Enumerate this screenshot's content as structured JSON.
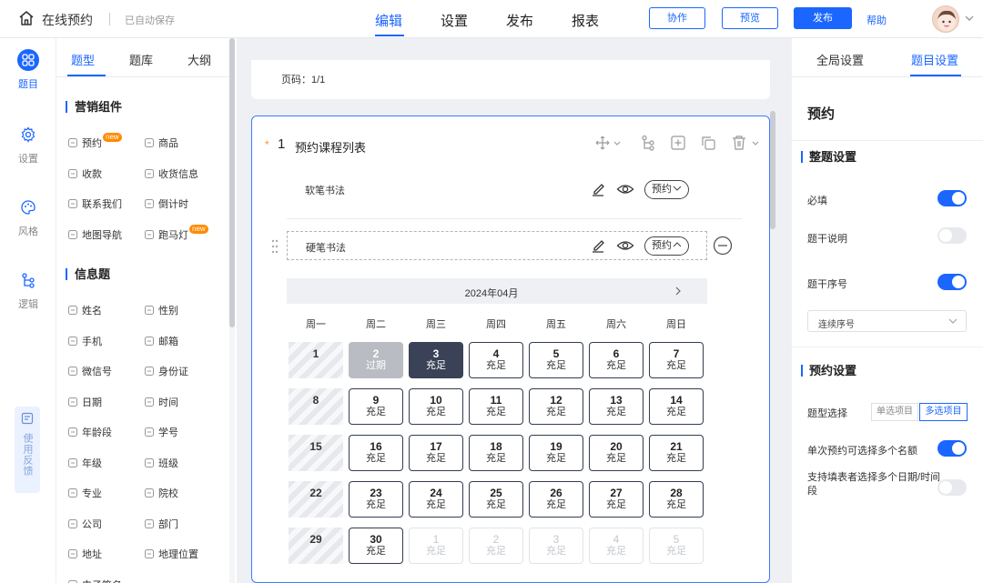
{
  "topbar": {
    "title": "在线预约",
    "saved": "已自动保存",
    "nav": [
      "编辑",
      "设置",
      "发布",
      "报表"
    ],
    "collab": "协作",
    "preview": "预览",
    "publish": "发布",
    "help": "帮助"
  },
  "rail": {
    "items": [
      {
        "label": "题目",
        "icon": "grid-icon"
      },
      {
        "label": "设置",
        "icon": "gear-icon"
      },
      {
        "label": "风格",
        "icon": "palette-icon"
      },
      {
        "label": "逻辑",
        "icon": "logic-icon"
      }
    ],
    "feedback": "使用反馈"
  },
  "panel": {
    "tabs": [
      "题型",
      "题库",
      "大纲"
    ],
    "marketing_title": "营销组件",
    "new_badge": "new",
    "marketing": [
      {
        "label": "预约",
        "badge": true
      },
      {
        "label": "商品"
      },
      {
        "label": "收款"
      },
      {
        "label": "收货信息"
      },
      {
        "label": "联系我们"
      },
      {
        "label": "倒计时"
      },
      {
        "label": "地图导航"
      },
      {
        "label": "跑马灯",
        "badge": true
      }
    ],
    "info_title": "信息题",
    "info": [
      {
        "label": "姓名"
      },
      {
        "label": "性别"
      },
      {
        "label": "手机"
      },
      {
        "label": "邮箱"
      },
      {
        "label": "微信号"
      },
      {
        "label": "身份证"
      },
      {
        "label": "日期"
      },
      {
        "label": "时间"
      },
      {
        "label": "年龄段"
      },
      {
        "label": "学号"
      },
      {
        "label": "年级"
      },
      {
        "label": "班级"
      },
      {
        "label": "专业"
      },
      {
        "label": "院校"
      },
      {
        "label": "公司"
      },
      {
        "label": "部门"
      },
      {
        "label": "地址"
      },
      {
        "label": "地理位置"
      },
      {
        "label": "电子签名"
      }
    ]
  },
  "canvas": {
    "page_label": "页码：1/1",
    "question": {
      "star": "*",
      "number": "1",
      "title": "预约课程列表",
      "options": [
        {
          "text": "软笔书法",
          "tag": "预约",
          "caret": "down"
        },
        {
          "text": "硬笔书法",
          "tag": "预约",
          "caret": "up"
        }
      ]
    },
    "calendar": {
      "month": "2024年04月",
      "weekdays": [
        "周一",
        "周二",
        "周三",
        "周四",
        "周五",
        "周六",
        "周日"
      ],
      "weeks": [
        [
          {
            "n": "1",
            "s": "",
            "state": "blank"
          },
          {
            "n": "2",
            "s": "过期",
            "state": "past"
          },
          {
            "n": "3",
            "s": "充足",
            "state": "sel"
          },
          {
            "n": "4",
            "s": "充足",
            "state": "normal"
          },
          {
            "n": "5",
            "s": "充足",
            "state": "normal"
          },
          {
            "n": "6",
            "s": "充足",
            "state": "normal"
          },
          {
            "n": "7",
            "s": "充足",
            "state": "normal"
          }
        ],
        [
          {
            "n": "8",
            "s": "",
            "state": "blank"
          },
          {
            "n": "9",
            "s": "充足",
            "state": "normal"
          },
          {
            "n": "10",
            "s": "充足",
            "state": "normal"
          },
          {
            "n": "11",
            "s": "充足",
            "state": "normal"
          },
          {
            "n": "12",
            "s": "充足",
            "state": "normal"
          },
          {
            "n": "13",
            "s": "充足",
            "state": "normal"
          },
          {
            "n": "14",
            "s": "充足",
            "state": "normal"
          }
        ],
        [
          {
            "n": "15",
            "s": "",
            "state": "blank"
          },
          {
            "n": "16",
            "s": "充足",
            "state": "normal"
          },
          {
            "n": "17",
            "s": "充足",
            "state": "normal"
          },
          {
            "n": "18",
            "s": "充足",
            "state": "normal"
          },
          {
            "n": "19",
            "s": "充足",
            "state": "normal"
          },
          {
            "n": "20",
            "s": "充足",
            "state": "normal"
          },
          {
            "n": "21",
            "s": "充足",
            "state": "normal"
          }
        ],
        [
          {
            "n": "22",
            "s": "",
            "state": "blank"
          },
          {
            "n": "23",
            "s": "充足",
            "state": "normal"
          },
          {
            "n": "24",
            "s": "充足",
            "state": "normal"
          },
          {
            "n": "25",
            "s": "充足",
            "state": "normal"
          },
          {
            "n": "26",
            "s": "充足",
            "state": "normal"
          },
          {
            "n": "27",
            "s": "充足",
            "state": "normal"
          },
          {
            "n": "28",
            "s": "充足",
            "state": "normal"
          }
        ],
        [
          {
            "n": "29",
            "s": "",
            "state": "blank"
          },
          {
            "n": "30",
            "s": "充足",
            "state": "normal"
          },
          {
            "n": "1",
            "s": "充足",
            "state": "muted"
          },
          {
            "n": "2",
            "s": "充足",
            "state": "muted"
          },
          {
            "n": "3",
            "s": "充足",
            "state": "muted"
          },
          {
            "n": "4",
            "s": "充足",
            "state": "muted"
          },
          {
            "n": "5",
            "s": "充足",
            "state": "muted"
          }
        ]
      ]
    }
  },
  "settings": {
    "tabs": [
      "全局设置",
      "题目设置"
    ],
    "heading": "预约",
    "whole_title": "整题设置",
    "required": "必填",
    "description": "题干说明",
    "numbering": "题干序号",
    "numbering_select": "连续序号",
    "booking_title": "预约设置",
    "type_label": "题型选择",
    "type_options": [
      "单选项目",
      "多选项目"
    ],
    "multi_quota": "单次预约可选择多个名额",
    "multi_dates": "支持填表者选择多个日期/时间段",
    "toggles": {
      "required": true,
      "description": false,
      "numbering": true,
      "multi_quota": true,
      "multi_dates": false
    },
    "accent": "#1a66ff"
  }
}
